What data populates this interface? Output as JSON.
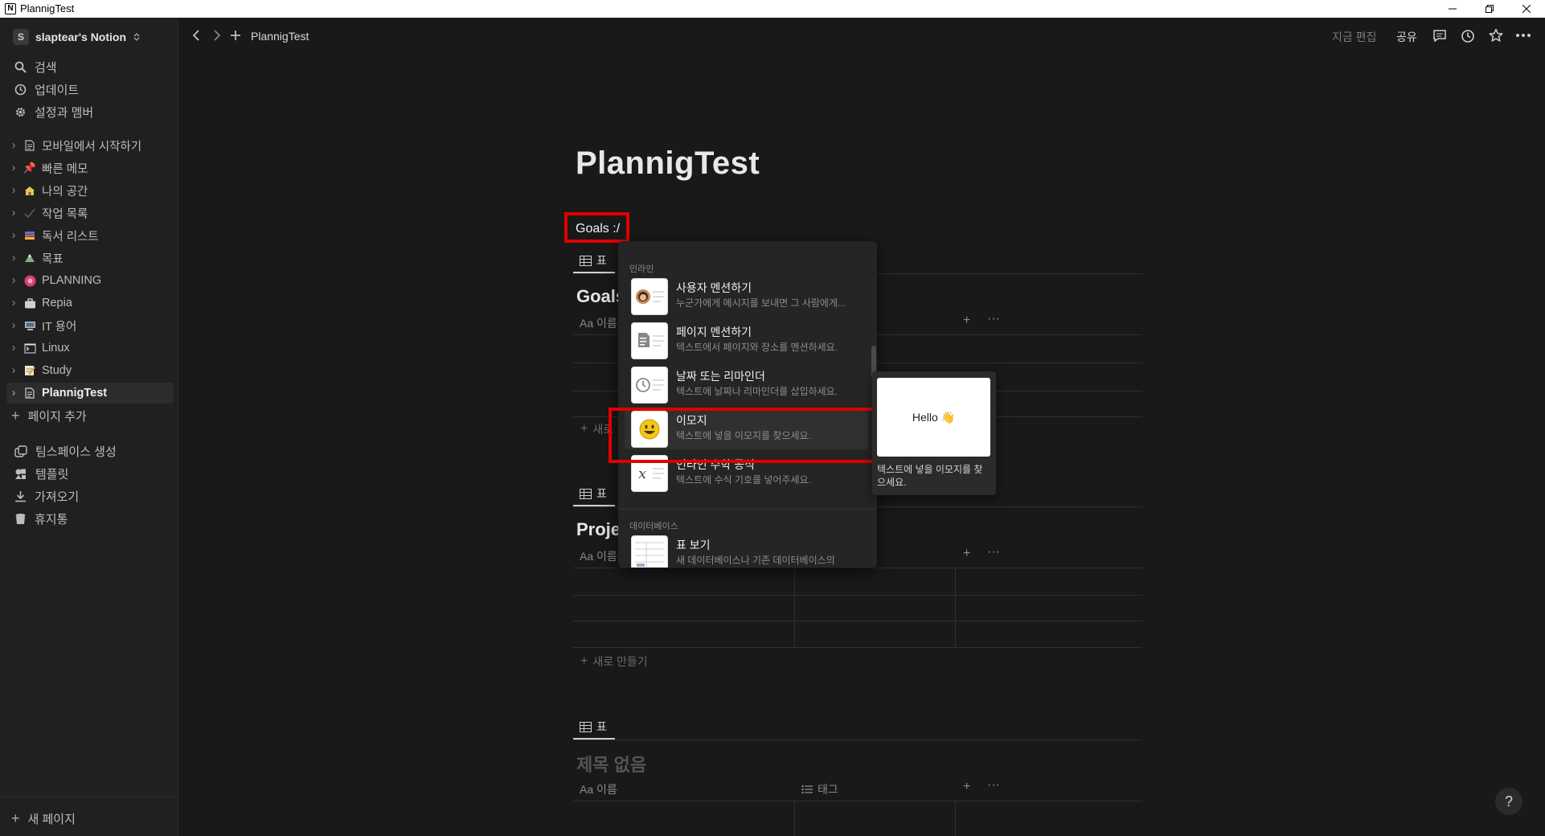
{
  "window": {
    "title": "PlannigTest",
    "app_icon": "N"
  },
  "sidebar": {
    "workspace": {
      "initial": "S",
      "name": "slaptear's Notion"
    },
    "nav": [
      {
        "label": "검색",
        "icon": "search-icon"
      },
      {
        "label": "업데이트",
        "icon": "clock-icon"
      },
      {
        "label": "설정과 멤버",
        "icon": "gear-icon"
      }
    ],
    "pages": [
      {
        "label": "모바일에서 시작하기",
        "icon": "page-icon"
      },
      {
        "label": "빠른 메모",
        "icon": "pushpin-icon"
      },
      {
        "label": "나의 공간",
        "icon": "house-icon"
      },
      {
        "label": "작업 목록",
        "icon": "checkmark-icon"
      },
      {
        "label": "독서 리스트",
        "icon": "books-icon"
      },
      {
        "label": "목표",
        "icon": "mountain-icon"
      },
      {
        "label": "PLANNING",
        "icon": "pink-flower-icon"
      },
      {
        "label": "Repia",
        "icon": "briefcase-icon"
      },
      {
        "label": "IT 용어",
        "icon": "computer-icon"
      },
      {
        "label": "Linux",
        "icon": "terminal-icon"
      },
      {
        "label": "Study",
        "icon": "memo-icon"
      },
      {
        "label": "PlannigTest",
        "icon": "page-icon",
        "active": true
      }
    ],
    "add_page": "페이지 추가",
    "tools": [
      {
        "label": "팀스페이스 생성",
        "icon": "teamspace-icon"
      },
      {
        "label": "템플릿",
        "icon": "template-icon"
      },
      {
        "label": "가져오기",
        "icon": "download-icon"
      },
      {
        "label": "휴지통",
        "icon": "trash-icon"
      }
    ],
    "new_page": "새 페이지"
  },
  "topbar": {
    "breadcrumb": "PlannigTest",
    "edited": "지금 편집",
    "share": "공유"
  },
  "page": {
    "title": "PlannigTest",
    "typed_text": "Goals :/",
    "databases": [
      {
        "tab": "표",
        "title": "Goals",
        "col_name": "Aa 이름",
        "new": "새로"
      },
      {
        "tab": "표",
        "title": "Proje",
        "col_name": "Aa 이름",
        "new": "새로 만들기"
      },
      {
        "tab": "표",
        "title": "제목 없음",
        "col_name": "Aa 이름",
        "col_tag": "태그"
      }
    ]
  },
  "menu": {
    "section_inline": "인라인",
    "section_database": "데이터베이스",
    "items": [
      {
        "title": "사용자 멘션하기",
        "desc": "누군가에게 메시지를 보내면 그 사람에게...",
        "icon": "user-avatar-icon"
      },
      {
        "title": "페이지 멘션하기",
        "desc": "텍스트에서 페이지와 장소를 멘션하세요.",
        "icon": "page-icon"
      },
      {
        "title": "날짜 또는 리마인더",
        "desc": "텍스트에 날짜나 리마인더를 삽입하세요.",
        "icon": "clock-icon"
      },
      {
        "title": "이모지",
        "desc": "텍스트에 넣을 이모지를 찾으세요.",
        "icon": "smiley-icon",
        "highlighted": true
      },
      {
        "title": "인라인 수학 공식",
        "desc": "텍스트에 수식 기호를 넣어주세요.",
        "icon": "math-icon"
      },
      {
        "title": "표 보기",
        "desc": "새 데이터베이스나 기존 데이터베이스의",
        "icon": "table-icon"
      }
    ]
  },
  "preview": {
    "card_text": "Hello",
    "card_emoji": "👋",
    "desc": "텍스트에 넣을 이모지를 찾으세요."
  },
  "help": "?"
}
